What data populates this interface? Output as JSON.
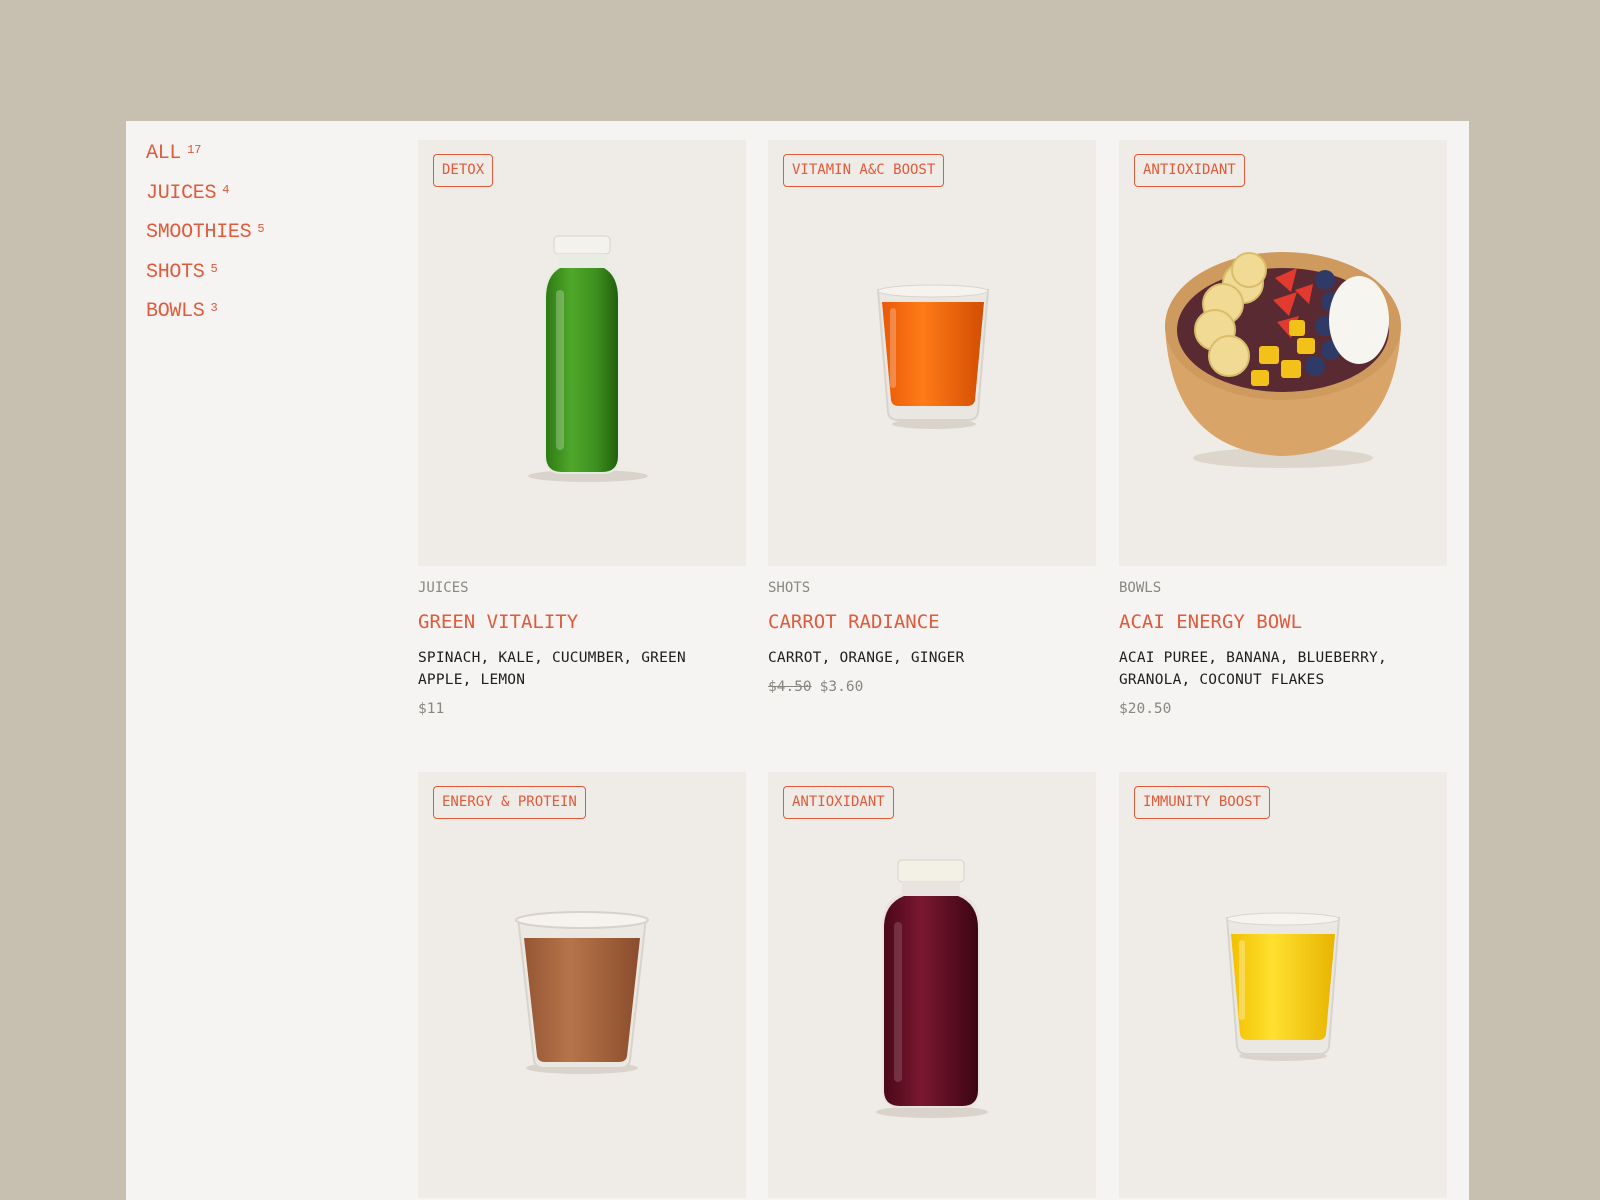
{
  "sidebar": {
    "categories": [
      {
        "label": "ALL",
        "count": "17"
      },
      {
        "label": "JUICES",
        "count": "4"
      },
      {
        "label": "SMOOTHIES",
        "count": "5"
      },
      {
        "label": "SHOTS",
        "count": "5"
      },
      {
        "label": "BOWLS",
        "count": "3"
      }
    ]
  },
  "products": [
    {
      "tag": "DETOX",
      "category": "JUICES",
      "name": "GREEN VITALITY",
      "ingredients": "SPINACH, KALE, CUCUMBER, GREEN APPLE, LEMON",
      "price": "$11",
      "image": "green-juice-bottle",
      "color": "#3d8f1f"
    },
    {
      "tag": "VITAMIN A&C BOOST",
      "category": "SHOTS",
      "name": "CARROT RADIANCE",
      "ingredients": "CARROT, ORANGE, GINGER",
      "old_price": "$4.50",
      "price": "$3.60",
      "image": "orange-shot-glass",
      "color": "#f06a10"
    },
    {
      "tag": "ANTIOXIDANT",
      "category": "BOWLS",
      "name": "ACAI ENERGY BOWL",
      "ingredients": "ACAI PUREE, BANANA, BLUEBERRY, GRANOLA, COCONUT FLAKES",
      "price": "$20.50",
      "image": "acai-bowl",
      "color": "#d9a468"
    },
    {
      "tag": "ENERGY & PROTEIN",
      "image": "chocolate-smoothie-cup",
      "color": "#a8643e"
    },
    {
      "tag": "ANTIOXIDANT",
      "image": "berry-juice-bottle",
      "color": "#5c0c1e"
    },
    {
      "tag": "IMMUNITY BOOST",
      "image": "yellow-shot-glass",
      "color": "#f5c80a"
    }
  ],
  "colors": {
    "accent": "#e05a3c",
    "page_bg": "#c7c0b0",
    "panel_bg": "#f5f4f2",
    "card_bg": "#efebe6"
  }
}
